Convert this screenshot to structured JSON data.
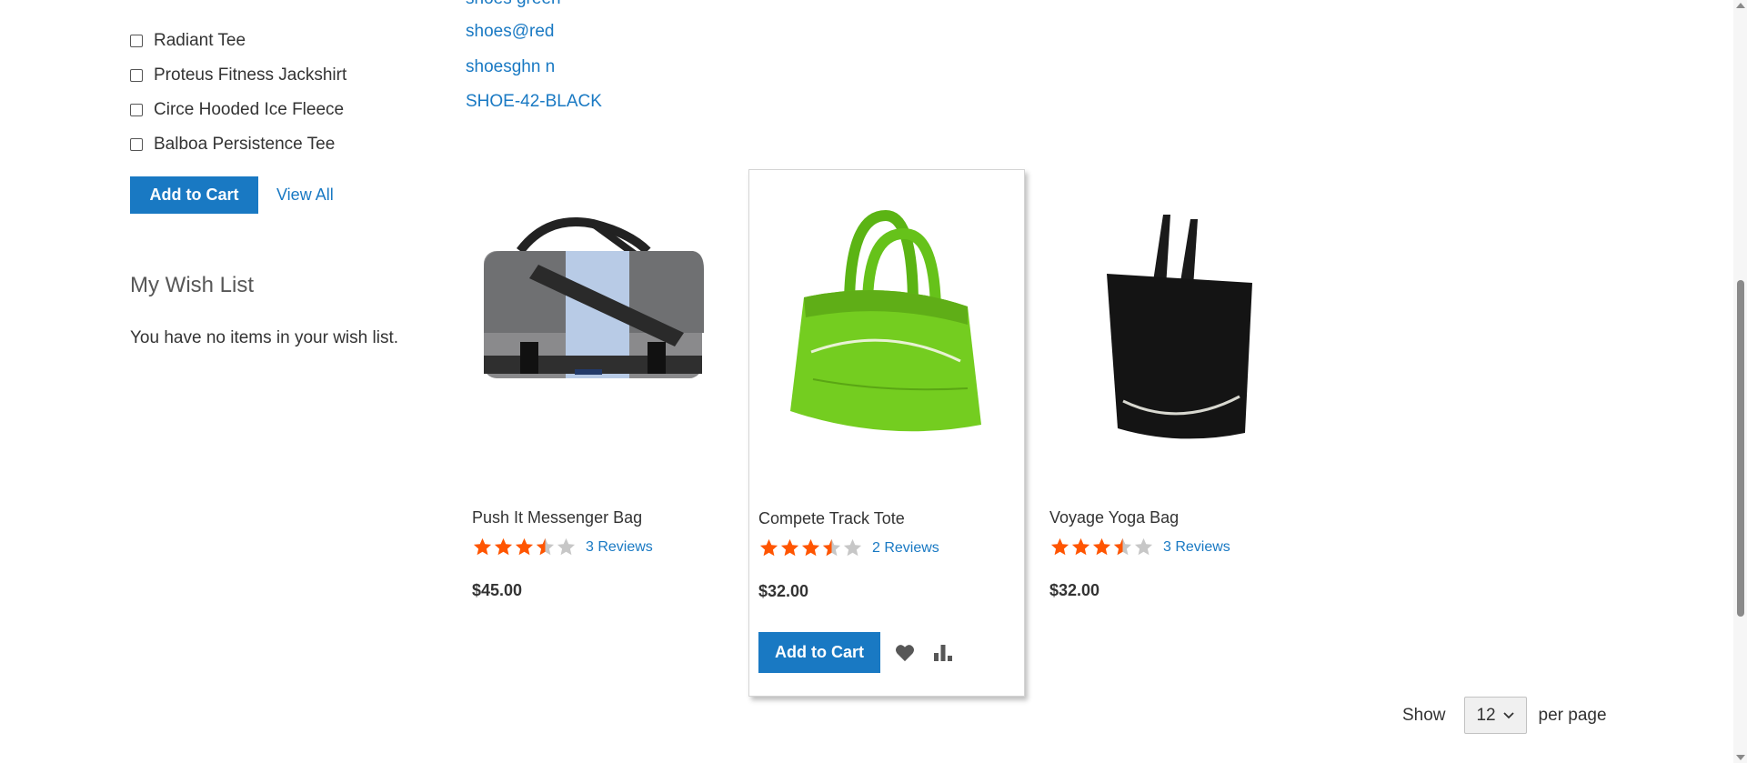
{
  "compare": {
    "items": [
      {
        "label": "Radiant Tee"
      },
      {
        "label": "Proteus Fitness Jackshirt"
      },
      {
        "label": "Circe Hooded Ice Fleece"
      },
      {
        "label": "Balboa Persistence Tee"
      }
    ],
    "add_to_cart_label": "Add to Cart",
    "view_all_label": "View All"
  },
  "wishlist": {
    "title": "My Wish List",
    "empty_text": "You have no items in your wish list."
  },
  "top_links": [
    {
      "label": "shoes green"
    },
    {
      "label": "shoes@red"
    },
    {
      "label": "shoesghn n"
    },
    {
      "label": "SHOE-42-BLACK"
    }
  ],
  "products": [
    {
      "name": "Push It Messenger Bag",
      "rating": 3.5,
      "reviews_label": "3 Reviews",
      "price": "$45.00",
      "image": "gray-messenger-bag"
    },
    {
      "name": "Compete Track Tote",
      "rating": 3.5,
      "reviews_label": "2 Reviews",
      "price": "$32.00",
      "image": "green-tote-bag",
      "add_to_cart_label": "Add to Cart"
    },
    {
      "name": "Voyage Yoga Bag",
      "rating": 3.5,
      "reviews_label": "3 Reviews",
      "price": "$32.00",
      "image": "black-yoga-bag"
    }
  ],
  "toolbar": {
    "show_label": "Show",
    "limiter_value": "12",
    "per_page_label": "per page"
  },
  "icons": {
    "wishlist": "heart-icon",
    "compare": "bar-chart-icon",
    "dropdown": "chevron-down-icon"
  },
  "colors": {
    "accent": "#1979c3",
    "star": "#ff5501",
    "star_empty": "#c7c7c7"
  }
}
